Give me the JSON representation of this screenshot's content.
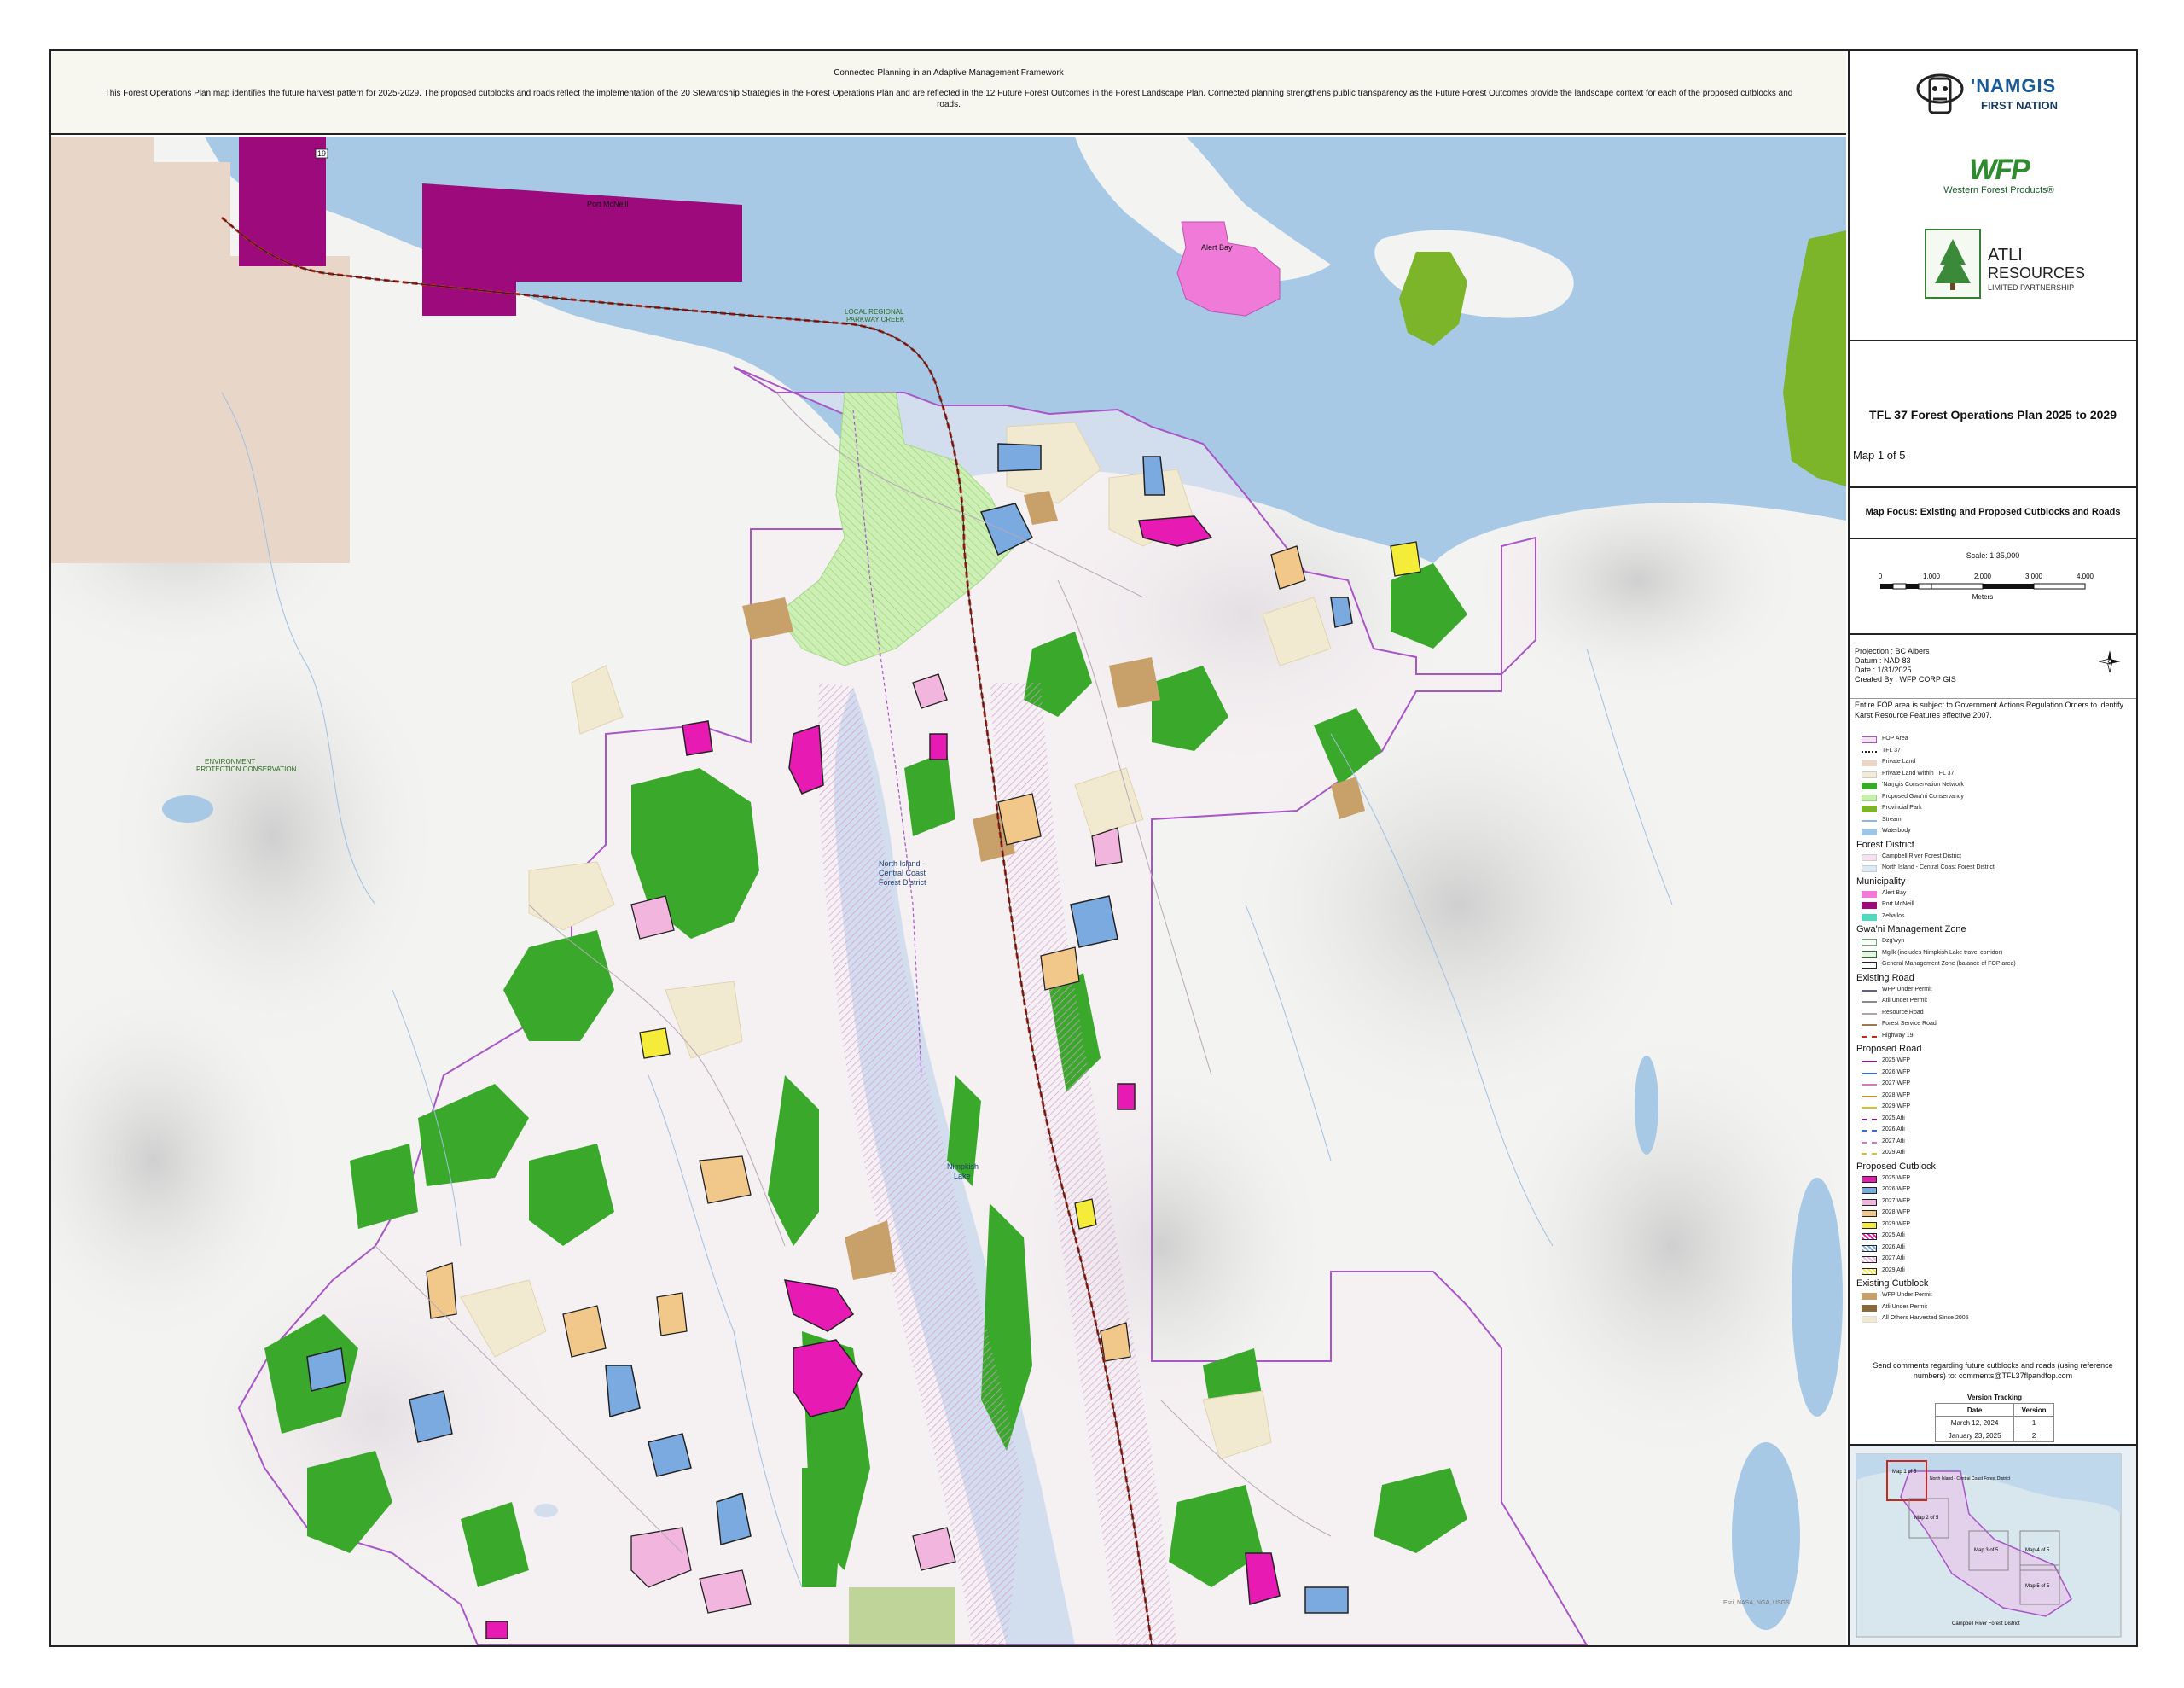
{
  "header": {
    "title": "Connected Planning in an Adaptive Management Framework",
    "description": "This Forest Operations Plan map identifies the future harvest pattern for 2025-2029.  The proposed cutblocks and roads reflect the implementation of the 20 Stewardship Strategies in the Forest Operations Plan and are reflected in the 12 Future Forest Outcomes in the Forest Landscape Plan.  Connected planning strengthens public transparency as the Future Forest Outcomes provide the landscape context for each of the proposed cutblocks and roads."
  },
  "logos": {
    "namgis_line1": "'NAMGIS",
    "namgis_line2": "FIRST NATION",
    "wfp_mark": "WFP",
    "wfp_name": "Western Forest Products®",
    "atli_line1": "ATLI",
    "atli_line2": "RESOURCES",
    "atli_line3": "LIMITED PARTNERSHIP"
  },
  "title_block": {
    "title": "TFL 37 Forest Operations Plan 2025 to 2029",
    "map_number": "Map 1 of 5"
  },
  "map_focus": "Map Focus: Existing and Proposed Cutblocks and Roads",
  "scale": {
    "label": "Scale: 1:35,000",
    "ticks": [
      "0",
      "1,000",
      "2,000",
      "3,000",
      "4,000"
    ],
    "unit": "Meters"
  },
  "projection": {
    "projection": "Projection : BC Albers",
    "datum": "Datum : NAD 83",
    "date": "Date : 1/31/2025",
    "created_by": "Created By : WFP CORP GIS"
  },
  "karst_note": "Entire FOP area is subject to Government Actions Regulation Orders to identify Karst Resource Features effective 2007.",
  "legend": {
    "general": [
      {
        "label": "FOP Area",
        "kind": "fill",
        "fill": "#f3e3f3",
        "stroke": "#a855c7"
      },
      {
        "label": "TFL 37",
        "kind": "line",
        "stroke": "#222",
        "dash": "dotted"
      },
      {
        "label": "Private Land",
        "kind": "fill",
        "fill": "#e8d6c8",
        "stroke": "#e8d6c8"
      },
      {
        "label": "Private Land Within TFL 37",
        "kind": "fill",
        "fill": "#f4ecd8",
        "stroke": "#ccc"
      },
      {
        "label": "'Nam̱gis Conservation Network",
        "kind": "fill",
        "fill": "#3aa82a",
        "stroke": "#3aa82a"
      },
      {
        "label": "Proposed Gwa'ni Conservancy",
        "kind": "fill",
        "fill": "#c8eeb0",
        "stroke": "#9ad27a"
      },
      {
        "label": "Provincial Park",
        "kind": "fill",
        "fill": "#7db52a",
        "stroke": "#7db52a"
      },
      {
        "label": "Stream",
        "kind": "line",
        "stroke": "#8fb8e0",
        "dash": "solid"
      },
      {
        "label": "Waterbody",
        "kind": "fill",
        "fill": "#9fc6e4",
        "stroke": "#9fc6e4"
      }
    ],
    "forest_district": {
      "heading": "Forest District",
      "items": [
        {
          "label": "Campbell River Forest District",
          "kind": "fill",
          "fill": "#f6e2f0",
          "stroke": "#ccc"
        },
        {
          "label": "North Island - Central Coast Forest District",
          "kind": "fill",
          "fill": "#dceaf6",
          "stroke": "#ccc"
        }
      ]
    },
    "municipality": {
      "heading": "Municipality",
      "items": [
        {
          "label": "Alert Bay",
          "kind": "fill",
          "fill": "#f07ad8",
          "stroke": "#f07ad8"
        },
        {
          "label": "Port McNeill",
          "kind": "fill",
          "fill": "#9c0a7c",
          "stroke": "#9c0a7c"
        },
        {
          "label": "Zeballos",
          "kind": "fill",
          "fill": "#4fd8c0",
          "stroke": "#4fd8c0"
        }
      ]
    },
    "management_zone": {
      "heading": "Gwa'ni Management Zone",
      "items": [
        {
          "label": "Dzg'wyn",
          "kind": "fill",
          "fill": "#ffffff",
          "stroke": "#6aa86a"
        },
        {
          "label": "Mgilk (includes Nimpkish Lake travel corridor)",
          "kind": "fill",
          "fill": "#e6f3e6",
          "stroke": "#2a6a2a"
        },
        {
          "label": "General Management Zone (balance of FOP area)",
          "kind": "fill",
          "fill": "#ffffff",
          "stroke": "#222"
        }
      ]
    },
    "existing_road": {
      "heading": "Existing Road",
      "items": [
        {
          "label": "WFP Under Permit",
          "kind": "line",
          "stroke": "#6b5a8a",
          "dash": "solid"
        },
        {
          "label": "Atli Under Permit",
          "kind": "line",
          "stroke": "#8a8a8a",
          "dash": "solid"
        },
        {
          "label": "Resource Road",
          "kind": "line",
          "stroke": "#b0a0b0",
          "dash": "solid"
        },
        {
          "label": "Forest Service Road",
          "kind": "line",
          "stroke": "#a07850",
          "dash": "solid"
        },
        {
          "label": "Highway 19",
          "kind": "line",
          "stroke": "#c8281e",
          "dash": "dashed"
        }
      ]
    },
    "proposed_road": {
      "heading": "Proposed Road",
      "items": [
        {
          "label": "2025 WFP",
          "kind": "line",
          "stroke": "#8a1a8a",
          "dash": "solid"
        },
        {
          "label": "2026 WFP",
          "kind": "line",
          "stroke": "#3a6ad0",
          "dash": "solid"
        },
        {
          "label": "2027 WFP",
          "kind": "line",
          "stroke": "#d07ac0",
          "dash": "solid"
        },
        {
          "label": "2028 WFP",
          "kind": "line",
          "stroke": "#c0903a",
          "dash": "solid"
        },
        {
          "label": "2029 WFP",
          "kind": "line",
          "stroke": "#d8c02a",
          "dash": "solid"
        },
        {
          "label": "2025 Atli",
          "kind": "line",
          "stroke": "#8a1a8a",
          "dash": "dashed"
        },
        {
          "label": "2026 Atli",
          "kind": "line",
          "stroke": "#3a6ad0",
          "dash": "dashed"
        },
        {
          "label": "2027 Atli",
          "kind": "line",
          "stroke": "#d07ac0",
          "dash": "dashed"
        },
        {
          "label": "2029 Atli",
          "kind": "line",
          "stroke": "#d8c02a",
          "dash": "dashed"
        }
      ]
    },
    "proposed_cutblock": {
      "heading": "Proposed Cutblock",
      "items": [
        {
          "label": "2025 WFP",
          "kind": "fill",
          "fill": "#e81ab4",
          "stroke": "#222"
        },
        {
          "label": "2026 WFP",
          "kind": "fill",
          "fill": "#7aaae0",
          "stroke": "#222"
        },
        {
          "label": "2027 WFP",
          "kind": "fill",
          "fill": "#f2b6de",
          "stroke": "#222"
        },
        {
          "label": "2028 WFP",
          "kind": "fill",
          "fill": "#f2c88a",
          "stroke": "#222"
        },
        {
          "label": "2029 WFP",
          "kind": "fill",
          "fill": "#f5ec3a",
          "stroke": "#222"
        },
        {
          "label": "2025 Atli",
          "kind": "hatch",
          "fill": "#e81ab4",
          "stroke": "#222"
        },
        {
          "label": "2026 Atli",
          "kind": "hatch",
          "fill": "#7aaae0",
          "stroke": "#222"
        },
        {
          "label": "2027 Atli",
          "kind": "hatch",
          "fill": "#f2b6de",
          "stroke": "#222"
        },
        {
          "label": "2029 Atli",
          "kind": "hatch",
          "fill": "#f5ec3a",
          "stroke": "#222"
        }
      ]
    },
    "existing_cutblock": {
      "heading": "Existing Cutblock",
      "items": [
        {
          "label": "WFP Under Permit",
          "kind": "fill",
          "fill": "#c8a06a",
          "stroke": "#c8a06a"
        },
        {
          "label": "Atli Under Permit",
          "kind": "fill",
          "fill": "#8a6a3a",
          "stroke": "#8a6a3a"
        },
        {
          "label": "All Others Harvested Since 2005",
          "kind": "fill",
          "fill": "#f1ead0",
          "stroke": "#ddd"
        }
      ]
    }
  },
  "comments": "Send comments regarding future cutblocks and roads (using reference numbers) to: comments@TFL37flpandfop.com",
  "version_tracking": {
    "caption": "Version Tracking",
    "headers": [
      "Date",
      "Version"
    ],
    "rows": [
      [
        "March 12, 2024",
        "1"
      ],
      [
        "January 23, 2025",
        "2"
      ]
    ]
  },
  "inset": {
    "labels": [
      "Map 1 of 5",
      "North Island - Central Coast Forest District",
      "Map 2 of 5",
      "Map 3 of 5",
      "Map 4 of 5",
      "Map 5 of 5",
      "Campbell River Forest District"
    ]
  },
  "map_labels": {
    "port_mcneill": "Port McNeill",
    "alert_bay": "Alert Bay",
    "district_line1": "North Island -",
    "district_line2": "Central Coast",
    "district_line3": "Forest District",
    "nimpkish_lake_1": "Nimpkish",
    "nimpkish_lake_2": "Lake",
    "parkway_line1": "LOCAL REGIONAL",
    "parkway_line2": "PARKWAY CREEK",
    "protection_area_1": "ENVIRONMENT",
    "protection_area_2": "PROTECTION CONSERVATION",
    "highway_shield": "19",
    "credits": "Esri, NASA, NGA, USGS"
  },
  "colors": {
    "water": "#a7c9e6",
    "terrain": "#f3f3f1",
    "conservation": "#3aa82a",
    "provincial_park": "#7db52a",
    "fop_boundary": "#a855c7",
    "highway": "#c8281e",
    "port_mcneill": "#9c0a7c",
    "alert_bay": "#f07ad8"
  }
}
